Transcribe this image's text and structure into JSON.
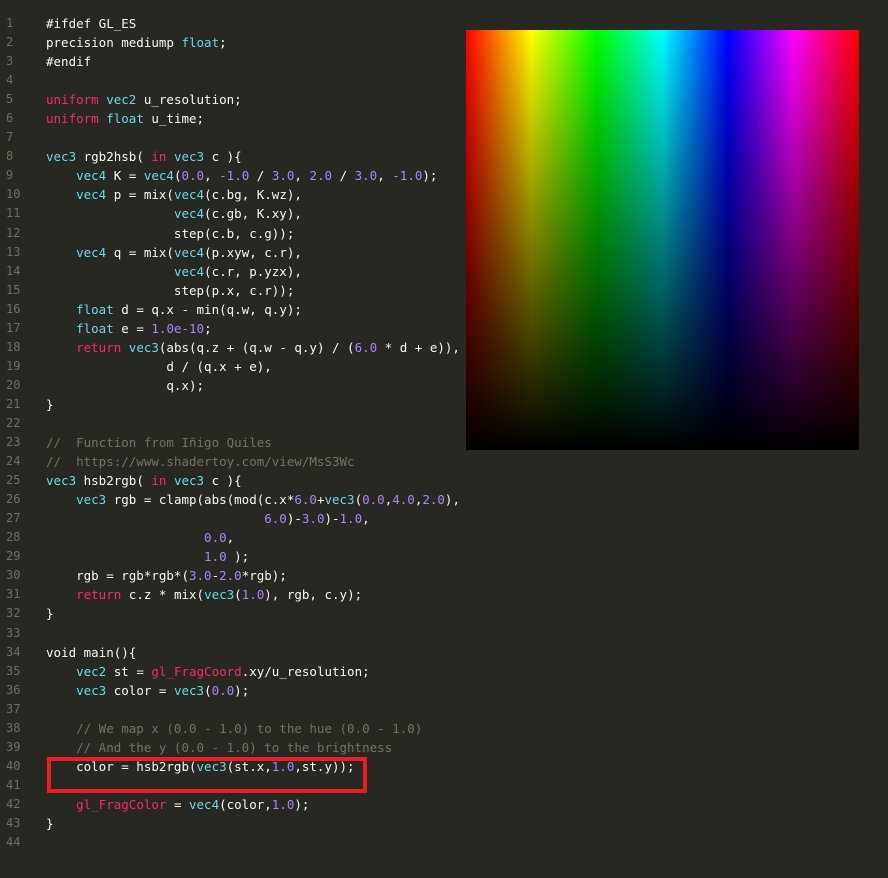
{
  "editor": {
    "lines": [
      {
        "n": "1",
        "t": [
          [
            "#ifdef GL_ES",
            "pl"
          ]
        ]
      },
      {
        "n": "2",
        "t": [
          [
            "precision mediump ",
            "pl"
          ],
          [
            "float",
            "ty"
          ],
          [
            ";",
            "pl"
          ]
        ]
      },
      {
        "n": "3",
        "t": [
          [
            "#endif",
            "pl"
          ]
        ]
      },
      {
        "n": "4",
        "t": []
      },
      {
        "n": "5",
        "t": [
          [
            "uniform",
            "kw"
          ],
          [
            " ",
            "pl"
          ],
          [
            "vec2",
            "ty"
          ],
          [
            " u_resolution;",
            "pl"
          ]
        ]
      },
      {
        "n": "6",
        "t": [
          [
            "uniform",
            "kw"
          ],
          [
            " ",
            "pl"
          ],
          [
            "float",
            "ty"
          ],
          [
            " u_time;",
            "pl"
          ]
        ]
      },
      {
        "n": "7",
        "t": []
      },
      {
        "n": "8",
        "t": [
          [
            "vec3",
            "ty"
          ],
          [
            " rgb2hsb( ",
            "pl"
          ],
          [
            "in",
            "kw"
          ],
          [
            " ",
            "pl"
          ],
          [
            "vec3",
            "ty"
          ],
          [
            " c ){",
            "pl"
          ]
        ]
      },
      {
        "n": "9",
        "t": [
          [
            "    ",
            "pl"
          ],
          [
            "vec4",
            "ty"
          ],
          [
            " K = ",
            "pl"
          ],
          [
            "vec4",
            "ty"
          ],
          [
            "(",
            "pl"
          ],
          [
            "0.0",
            "nu"
          ],
          [
            ", ",
            "pl"
          ],
          [
            "-1.0",
            "nu"
          ],
          [
            " / ",
            "pl"
          ],
          [
            "3.0",
            "nu"
          ],
          [
            ", ",
            "pl"
          ],
          [
            "2.0",
            "nu"
          ],
          [
            " / ",
            "pl"
          ],
          [
            "3.0",
            "nu"
          ],
          [
            ", ",
            "pl"
          ],
          [
            "-1.0",
            "nu"
          ],
          [
            ");",
            "pl"
          ]
        ]
      },
      {
        "n": "10",
        "t": [
          [
            "    ",
            "pl"
          ],
          [
            "vec4",
            "ty"
          ],
          [
            " p = mix(",
            "pl"
          ],
          [
            "vec4",
            "ty"
          ],
          [
            "(c.bg, K.wz),",
            "pl"
          ]
        ]
      },
      {
        "n": "11",
        "t": [
          [
            "                 ",
            "pl"
          ],
          [
            "vec4",
            "ty"
          ],
          [
            "(c.gb, K.xy),",
            "pl"
          ]
        ]
      },
      {
        "n": "12",
        "t": [
          [
            "                 step(c.b, c.g));",
            "pl"
          ]
        ]
      },
      {
        "n": "13",
        "t": [
          [
            "    ",
            "pl"
          ],
          [
            "vec4",
            "ty"
          ],
          [
            " q = mix(",
            "pl"
          ],
          [
            "vec4",
            "ty"
          ],
          [
            "(p.xyw, c.r),",
            "pl"
          ]
        ]
      },
      {
        "n": "14",
        "t": [
          [
            "                 ",
            "pl"
          ],
          [
            "vec4",
            "ty"
          ],
          [
            "(c.r, p.yzx),",
            "pl"
          ]
        ]
      },
      {
        "n": "15",
        "t": [
          [
            "                 step(p.x, c.r));",
            "pl"
          ]
        ]
      },
      {
        "n": "16",
        "t": [
          [
            "    ",
            "pl"
          ],
          [
            "float",
            "ty"
          ],
          [
            " d = q.x - min(q.w, q.y);",
            "pl"
          ]
        ]
      },
      {
        "n": "17",
        "t": [
          [
            "    ",
            "pl"
          ],
          [
            "float",
            "ty"
          ],
          [
            " e = ",
            "pl"
          ],
          [
            "1.0e-10",
            "nu"
          ],
          [
            ";",
            "pl"
          ]
        ]
      },
      {
        "n": "18",
        "t": [
          [
            "    ",
            "pl"
          ],
          [
            "return",
            "kw"
          ],
          [
            " ",
            "pl"
          ],
          [
            "vec3",
            "ty"
          ],
          [
            "(abs(q.z + (q.w - q.y) / (",
            "pl"
          ],
          [
            "6.0",
            "nu"
          ],
          [
            " * d + e)),",
            "pl"
          ]
        ]
      },
      {
        "n": "19",
        "t": [
          [
            "                d / (q.x + e),",
            "pl"
          ]
        ]
      },
      {
        "n": "20",
        "t": [
          [
            "                q.x);",
            "pl"
          ]
        ]
      },
      {
        "n": "21",
        "t": [
          [
            "}",
            "pl"
          ]
        ]
      },
      {
        "n": "22",
        "t": []
      },
      {
        "n": "23",
        "t": [
          [
            "//  Function from Iñigo Quiles",
            "cm"
          ]
        ]
      },
      {
        "n": "24",
        "t": [
          [
            "//  https://www.shadertoy.com/view/MsS3Wc",
            "cm"
          ]
        ]
      },
      {
        "n": "25",
        "t": [
          [
            "vec3",
            "ty"
          ],
          [
            " hsb2rgb( ",
            "pl"
          ],
          [
            "in",
            "kw"
          ],
          [
            " ",
            "pl"
          ],
          [
            "vec3",
            "ty"
          ],
          [
            " c ){",
            "pl"
          ]
        ]
      },
      {
        "n": "26",
        "t": [
          [
            "    ",
            "pl"
          ],
          [
            "vec3",
            "ty"
          ],
          [
            " rgb = clamp(abs(mod(c.x*",
            "pl"
          ],
          [
            "6.0",
            "nu"
          ],
          [
            "+",
            "pl"
          ],
          [
            "vec3",
            "ty"
          ],
          [
            "(",
            "pl"
          ],
          [
            "0.0",
            "nu"
          ],
          [
            ",",
            "pl"
          ],
          [
            "4.0",
            "nu"
          ],
          [
            ",",
            "pl"
          ],
          [
            "2.0",
            "nu"
          ],
          [
            "),",
            "pl"
          ]
        ]
      },
      {
        "n": "27",
        "t": [
          [
            "                             ",
            "pl"
          ],
          [
            "6.0",
            "nu"
          ],
          [
            ")-",
            "pl"
          ],
          [
            "3.0",
            "nu"
          ],
          [
            ")-",
            "pl"
          ],
          [
            "1.0",
            "nu"
          ],
          [
            ",",
            "pl"
          ]
        ]
      },
      {
        "n": "28",
        "t": [
          [
            "                     ",
            "pl"
          ],
          [
            "0.0",
            "nu"
          ],
          [
            ",",
            "pl"
          ]
        ]
      },
      {
        "n": "29",
        "t": [
          [
            "                     ",
            "pl"
          ],
          [
            "1.0",
            "nu"
          ],
          [
            " );",
            "pl"
          ]
        ]
      },
      {
        "n": "30",
        "t": [
          [
            "    rgb = rgb*rgb*(",
            "pl"
          ],
          [
            "3.0",
            "nu"
          ],
          [
            "-",
            "pl"
          ],
          [
            "2.0",
            "nu"
          ],
          [
            "*rgb);",
            "pl"
          ]
        ]
      },
      {
        "n": "31",
        "t": [
          [
            "    ",
            "pl"
          ],
          [
            "return",
            "kw"
          ],
          [
            " c.z * mix(",
            "pl"
          ],
          [
            "vec3",
            "ty"
          ],
          [
            "(",
            "pl"
          ],
          [
            "1.0",
            "nu"
          ],
          [
            "), rgb, c.y);",
            "pl"
          ]
        ]
      },
      {
        "n": "32",
        "t": [
          [
            "}",
            "pl"
          ]
        ]
      },
      {
        "n": "33",
        "t": []
      },
      {
        "n": "34",
        "t": [
          [
            "void main(){",
            "pl"
          ]
        ]
      },
      {
        "n": "35",
        "t": [
          [
            "    ",
            "pl"
          ],
          [
            "vec2",
            "ty"
          ],
          [
            " st = ",
            "pl"
          ],
          [
            "gl_FragCoord",
            "kw"
          ],
          [
            ".xy/u_resolution;",
            "pl"
          ]
        ]
      },
      {
        "n": "36",
        "t": [
          [
            "    ",
            "pl"
          ],
          [
            "vec3",
            "ty"
          ],
          [
            " color = ",
            "pl"
          ],
          [
            "vec3",
            "ty"
          ],
          [
            "(",
            "pl"
          ],
          [
            "0.0",
            "nu"
          ],
          [
            ");",
            "pl"
          ]
        ]
      },
      {
        "n": "37",
        "t": []
      },
      {
        "n": "38",
        "t": [
          [
            "    // We map x (0.0 - 1.0) to the hue (0.0 - 1.0)",
            "cm"
          ]
        ]
      },
      {
        "n": "39",
        "t": [
          [
            "    // And the y (0.0 - 1.0) to the brightness",
            "cm"
          ]
        ]
      },
      {
        "n": "40",
        "t": [
          [
            "    color = hsb2rgb(",
            "pl"
          ],
          [
            "vec3",
            "ty"
          ],
          [
            "(st.x,",
            "pl"
          ],
          [
            "1.0",
            "nu"
          ],
          [
            ",st.y));",
            "pl"
          ]
        ]
      },
      {
        "n": "41",
        "t": []
      },
      {
        "n": "42",
        "t": [
          [
            "    ",
            "pl"
          ],
          [
            "gl_FragColor",
            "kw"
          ],
          [
            " = ",
            "pl"
          ],
          [
            "vec4",
            "ty"
          ],
          [
            "(color,",
            "pl"
          ],
          [
            "1.0",
            "nu"
          ],
          [
            ");",
            "pl"
          ]
        ]
      },
      {
        "n": "43",
        "t": [
          [
            "}",
            "pl"
          ]
        ]
      },
      {
        "n": "44",
        "t": []
      }
    ]
  },
  "colors": {
    "background": "#272822",
    "keyword": "#f92672",
    "type": "#66d9ef",
    "number": "#ae81ff",
    "comment": "#75715e",
    "highlight_box": "#ed1c24"
  },
  "preview": {
    "hue_stops": [
      "#ff0000",
      "#ffff00",
      "#00ff00",
      "#00ffff",
      "#0000ff",
      "#ff00ff",
      "#ff0000"
    ],
    "brightness_bottom": "#000000"
  },
  "highlight": {
    "line_from": 40,
    "line_to": 41
  }
}
